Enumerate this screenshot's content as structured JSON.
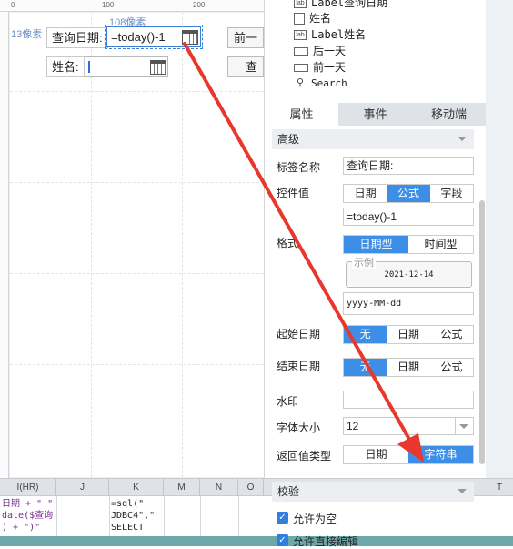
{
  "canvas": {
    "ruler_ticks": [
      "0",
      "100",
      "200"
    ],
    "width_hint": "108像素",
    "height_hint": "13像素",
    "query_date_label": "查询日期:",
    "date_input_value": "=today()-1",
    "name_label": "姓名:",
    "prev_day_button": "前一",
    "search_button": "查"
  },
  "tree": {
    "items": [
      {
        "text": "Label查询日期"
      },
      {
        "text": "姓名"
      },
      {
        "text": "Label姓名"
      },
      {
        "text": "后一天"
      },
      {
        "text": "前一天"
      },
      {
        "text": "Search"
      }
    ]
  },
  "panel": {
    "tabs": [
      {
        "label": "属性"
      },
      {
        "label": "事件"
      },
      {
        "label": "移动端"
      }
    ],
    "advanced": "高级",
    "tag_name_label": "标签名称",
    "tag_name_value": "查询日期:",
    "control_value_label": "控件值",
    "control_value_options": [
      "日期",
      "公式",
      "字段"
    ],
    "formula_value": "=today()-1",
    "format_label": "格式",
    "format_options": [
      "日期型",
      "时间型"
    ],
    "example_legend": "示例",
    "example_value": "2021-12-14",
    "format_pattern": "yyyy-MM-dd",
    "start_date_label": "起始日期",
    "start_date_options": [
      "无",
      "日期",
      "公式"
    ],
    "end_date_label": "结束日期",
    "end_date_options": [
      "无",
      "日期",
      "公式"
    ],
    "watermark_label": "水印",
    "font_size_label": "字体大小",
    "font_size_value": "12",
    "return_type_label": "返回值类型",
    "return_type_options": [
      "日期",
      "字符串"
    ],
    "validation": "校验",
    "allow_empty": "允许为空",
    "allow_direct_edit": "允许直接编辑"
  },
  "sheet": {
    "columns": [
      "I(HR)",
      "J",
      "K",
      "M",
      "N",
      "O",
      "T"
    ],
    "cells": {
      "i_line1": "日期 + \" \"",
      "i_line2": "date($查询",
      "i_line3": ") + \")\"",
      "k_line1": "=sql(\"",
      "k_line2": "JDBC4\",\"",
      "k_line3": "SELECT"
    }
  },
  "colors": {
    "accent": "#3c8ee6",
    "arrow": "#e8372c"
  }
}
